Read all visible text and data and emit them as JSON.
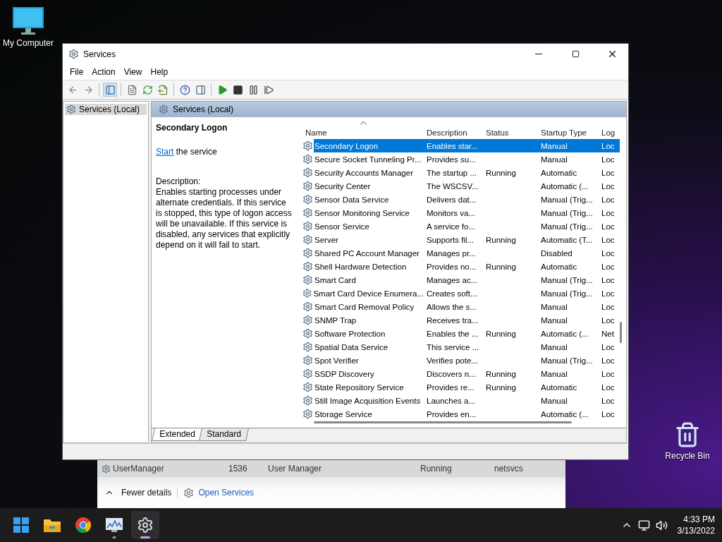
{
  "desktop_icons": [
    {
      "label": "My Computer",
      "kind": "computer"
    },
    {
      "label": "Recycle Bin",
      "kind": "recycle"
    }
  ],
  "window": {
    "title": "Services"
  },
  "menu": [
    "File",
    "Action",
    "View",
    "Help"
  ],
  "toolbar": {
    "tree_toggle_pressed": true
  },
  "tree": {
    "items": [
      {
        "label": "Services (Local)",
        "selected": true
      }
    ]
  },
  "panel": {
    "title": "Services (Local)",
    "service_name": "Secondary Logon",
    "action_link": "Start",
    "action_text": "the service",
    "description_label": "Description:",
    "description": "Enables starting processes under alternate credentials. If this service is stopped, this type of logon access will be unavailable. If this service is disabled, any services that explicitly depend on it will fail to start."
  },
  "table": {
    "columns": [
      {
        "label": "Name",
        "sorted": true
      },
      {
        "label": "Description",
        "sorted": false
      },
      {
        "label": "Status",
        "sorted": false
      },
      {
        "label": "Startup Type",
        "sorted": false
      },
      {
        "label": "Log",
        "sorted": false
      }
    ],
    "rows": [
      {
        "name": "Secondary Logon",
        "description": "Enables star...",
        "status": "",
        "startup_type": "Manual",
        "log_on": "Loc",
        "selected": true
      },
      {
        "name": "Secure Socket Tunneling Pr...",
        "description": "Provides su...",
        "status": "",
        "startup_type": "Manual",
        "log_on": "Loc",
        "selected": false
      },
      {
        "name": "Security Accounts Manager",
        "description": "The startup ...",
        "status": "Running",
        "startup_type": "Automatic",
        "log_on": "Loc",
        "selected": false
      },
      {
        "name": "Security Center",
        "description": "The WSCSV...",
        "status": "",
        "startup_type": "Automatic (...",
        "log_on": "Loc",
        "selected": false
      },
      {
        "name": "Sensor Data Service",
        "description": "Delivers dat...",
        "status": "",
        "startup_type": "Manual (Trig...",
        "log_on": "Loc",
        "selected": false
      },
      {
        "name": "Sensor Monitoring Service",
        "description": "Monitors va...",
        "status": "",
        "startup_type": "Manual (Trig...",
        "log_on": "Loc",
        "selected": false
      },
      {
        "name": "Sensor Service",
        "description": "A service fo...",
        "status": "",
        "startup_type": "Manual (Trig...",
        "log_on": "Loc",
        "selected": false
      },
      {
        "name": "Server",
        "description": "Supports fil...",
        "status": "Running",
        "startup_type": "Automatic (T...",
        "log_on": "Loc",
        "selected": false
      },
      {
        "name": "Shared PC Account Manager",
        "description": "Manages pr...",
        "status": "",
        "startup_type": "Disabled",
        "log_on": "Loc",
        "selected": false
      },
      {
        "name": "Shell Hardware Detection",
        "description": "Provides no...",
        "status": "Running",
        "startup_type": "Automatic",
        "log_on": "Loc",
        "selected": false
      },
      {
        "name": "Smart Card",
        "description": "Manages ac...",
        "status": "",
        "startup_type": "Manual (Trig...",
        "log_on": "Loc",
        "selected": false
      },
      {
        "name": "Smart Card Device Enumera...",
        "description": "Creates soft...",
        "status": "",
        "startup_type": "Manual (Trig...",
        "log_on": "Loc",
        "selected": false
      },
      {
        "name": "Smart Card Removal Policy",
        "description": "Allows the s...",
        "status": "",
        "startup_type": "Manual",
        "log_on": "Loc",
        "selected": false
      },
      {
        "name": "SNMP Trap",
        "description": "Receives tra...",
        "status": "",
        "startup_type": "Manual",
        "log_on": "Loc",
        "selected": false
      },
      {
        "name": "Software Protection",
        "description": "Enables the ...",
        "status": "Running",
        "startup_type": "Automatic (...",
        "log_on": "Net",
        "selected": false
      },
      {
        "name": "Spatial Data Service",
        "description": "This service ...",
        "status": "",
        "startup_type": "Manual",
        "log_on": "Loc",
        "selected": false
      },
      {
        "name": "Spot Verifier",
        "description": "Verifies pote...",
        "status": "",
        "startup_type": "Manual (Trig...",
        "log_on": "Loc",
        "selected": false
      },
      {
        "name": "SSDP Discovery",
        "description": "Discovers n...",
        "status": "Running",
        "startup_type": "Manual",
        "log_on": "Loc",
        "selected": false
      },
      {
        "name": "State Repository Service",
        "description": "Provides re...",
        "status": "Running",
        "startup_type": "Automatic",
        "log_on": "Loc",
        "selected": false
      },
      {
        "name": "Still Image Acquisition Events",
        "description": "Launches a...",
        "status": "",
        "startup_type": "Manual",
        "log_on": "Loc",
        "selected": false
      },
      {
        "name": "Storage Service",
        "description": "Provides en...",
        "status": "",
        "startup_type": "Automatic (...",
        "log_on": "Loc",
        "selected": false
      }
    ]
  },
  "view_tabs": [
    {
      "label": "Extended",
      "selected": true
    },
    {
      "label": "Standard",
      "selected": false
    }
  ],
  "task_manager": {
    "rows": [
      {
        "name": "UserManager",
        "pid": "1536",
        "description": "User Manager",
        "status": "Running",
        "group": "netsvcs"
      }
    ],
    "fewer_details": "Fewer details",
    "open_services": "Open Services"
  },
  "taskbar": {
    "apps": [
      {
        "kind": "start",
        "running": false,
        "selected": false
      },
      {
        "kind": "explorer",
        "running": false,
        "selected": false
      },
      {
        "kind": "browser",
        "running": false,
        "selected": false
      },
      {
        "kind": "monitor",
        "running": true,
        "selected": false
      },
      {
        "kind": "services",
        "running": true,
        "selected": true
      }
    ],
    "time": "4:33 PM",
    "date": "3/13/2022"
  }
}
